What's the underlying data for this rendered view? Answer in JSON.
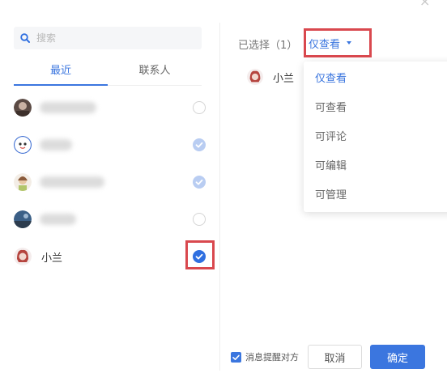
{
  "dialog": {
    "close_glyph": "×"
  },
  "search": {
    "placeholder": "搜索"
  },
  "tabs": [
    {
      "label": "最近",
      "active": true
    },
    {
      "label": "联系人",
      "active": false
    }
  ],
  "contacts": [
    {
      "name": "",
      "state": "unchecked"
    },
    {
      "name": "",
      "state": "disabled-checked"
    },
    {
      "name": "",
      "state": "disabled-checked"
    },
    {
      "name": "",
      "state": "unchecked"
    },
    {
      "name": "小兰",
      "state": "checked"
    }
  ],
  "selected": {
    "label": "已选择（1）",
    "permission": "仅查看",
    "items": [
      {
        "name": "小兰"
      }
    ]
  },
  "permission_menu": {
    "items": [
      {
        "label": "仅查看",
        "active": true
      },
      {
        "label": "可查看",
        "active": false
      },
      {
        "label": "可评论",
        "active": false
      },
      {
        "label": "可编辑",
        "active": false
      },
      {
        "label": "可管理",
        "active": false
      }
    ]
  },
  "footer": {
    "notify_label": "消息提醒对方",
    "notify_checked": true,
    "cancel_label": "取消",
    "ok_label": "确定"
  },
  "colors": {
    "accent": "#3b76df",
    "highlight": "#d9484e"
  },
  "icons": [
    "close-icon",
    "search-icon",
    "check-icon",
    "caret-down-icon"
  ]
}
